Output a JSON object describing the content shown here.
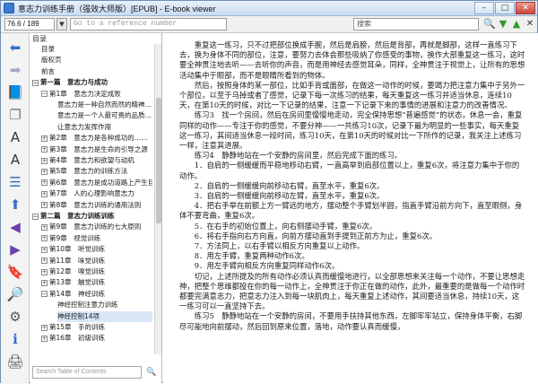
{
  "window": {
    "title": "意志力训练手册（强效大师版）[EPUB] - E-book viewer",
    "minimize": "–",
    "maximize": "□",
    "close": "✕"
  },
  "toolbar": {
    "page_value": "76.6 / 189",
    "goto_placeholder": "Go to a reference number",
    "search_value": "搜索",
    "search_button": "🔍",
    "next_button": "▼",
    "prev_button": "▲",
    "clear_button": "✕"
  },
  "sidebar_icons": [
    {
      "name": "back-arrow-icon",
      "glyph": "⬅",
      "color": "#3a6fc4"
    },
    {
      "name": "forward-arrow-icon",
      "glyph": "➡",
      "color": "#9aa9bf"
    },
    {
      "name": "library-icon",
      "glyph": "📘",
      "color": "#3a6fc4"
    },
    {
      "name": "copy-icon",
      "glyph": "❐",
      "color": "#777777"
    },
    {
      "name": "font-larger-icon",
      "glyph": "A",
      "color": "#333333"
    },
    {
      "name": "font-smaller-icon",
      "glyph": "A",
      "color": "#333333"
    },
    {
      "name": "toc-icon",
      "glyph": "☰",
      "color": "#3a6fc4"
    },
    {
      "name": "previous-page-icon",
      "glyph": "⬆",
      "color": "#3a6fc4"
    },
    {
      "name": "previous-chapter-icon",
      "glyph": "◀",
      "color": "#6a3fb0"
    },
    {
      "name": "next-chapter-icon",
      "glyph": "▶",
      "color": "#6a3fb0"
    },
    {
      "name": "bookmark-icon",
      "glyph": "🔖",
      "color": "#3a6fc4"
    },
    {
      "name": "reference-icon",
      "glyph": "🔎",
      "color": "#3a6fc4"
    },
    {
      "name": "preferences-icon",
      "glyph": "⚙",
      "color": "#555555"
    },
    {
      "name": "info-icon",
      "glyph": "ℹ",
      "color": "#2f6fd0"
    },
    {
      "name": "print-icon",
      "glyph": "🖨",
      "color": "#555555"
    }
  ],
  "toc": {
    "header": "目录",
    "items": [
      {
        "label": "目录",
        "level": 1
      },
      {
        "label": "版权页",
        "level": 1
      },
      {
        "label": "前言",
        "level": 1
      },
      {
        "label": "第一篇　意志力与成功",
        "level": 0,
        "toggle": "−"
      },
      {
        "label": "第1章　意志力决定成败",
        "level": 1,
        "toggle": "−"
      },
      {
        "label": "意志力是一种自然而然的精神……",
        "level": 2
      },
      {
        "label": "意志力是一个人最可贵的品质……",
        "level": 2
      },
      {
        "label": "让意志力发挥作用",
        "level": 2
      },
      {
        "label": "第2章　意志力是各种成功的……",
        "level": 1,
        "toggle": "+"
      },
      {
        "label": "第3章　意志力是生命的引导之源",
        "level": 1,
        "toggle": "+"
      },
      {
        "label": "第4章　意志力和欲望与动机",
        "level": 1,
        "toggle": "+"
      },
      {
        "label": "第5章　意志力的训练方法",
        "level": 1,
        "toggle": "+"
      },
      {
        "label": "第6章　意志力是成功道路上产生巨……",
        "level": 1,
        "toggle": "+"
      },
      {
        "label": "第7章　人的心理影响意志力",
        "level": 1,
        "toggle": "+"
      },
      {
        "label": "第8章　意志力训练的通用法则",
        "level": 1,
        "toggle": "+"
      },
      {
        "label": "第二篇　意志力训练训练",
        "level": 0,
        "toggle": "−"
      },
      {
        "label": "第9章　意志力训练的七大原则",
        "level": 1,
        "toggle": "+"
      },
      {
        "label": "第9章　视觉训练",
        "level": 1,
        "toggle": "+"
      },
      {
        "label": "第10章　听觉训练",
        "level": 1,
        "toggle": "+"
      },
      {
        "label": "第11章　味觉训练",
        "level": 1,
        "toggle": "+"
      },
      {
        "label": "第12章　嗅觉训练",
        "level": 1,
        "toggle": "+"
      },
      {
        "label": "第13章　触觉训练",
        "level": 1,
        "toggle": "+"
      },
      {
        "label": "第14章　神经训练",
        "level": 1,
        "toggle": "−"
      },
      {
        "label": "神经控制注意力训练",
        "level": 2
      },
      {
        "label": "神经控制14项",
        "level": 2,
        "selected": true
      },
      {
        "label": "第15章　手的训练",
        "level": 1,
        "toggle": "+"
      },
      {
        "label": "第16章　初级训练",
        "level": 1,
        "toggle": "+"
      }
    ],
    "search_placeholder": "Search Table of Contents",
    "search_button": "🔍"
  },
  "content": {
    "paragraphs": [
      "重复这一练习，只不过把部位换成手腕，然后是肩膀，然后是背部，再就是脚部，这样一直练习下去，换为身体不同的部位，注意，要努力去体会那些吸纳了你感受的事物，换作大部重复这一练习，这时要全神贯注地去听——去听你的声音，而是用神经去感觉耳朵，同样，全神贯注于视觉上，让所有的思想活动集中于眼部，而不是眼睛所看到的物体。",
      "然后，按照身体的某一部位，比如手背或面部，在做这一动作的时候，要竭力把注意力集中于另外一个部位，以至于马掉或者了感觉，记录下每一次练习的结果，每天重复这一练习并适当休息，连续10天，在第10天的时候，对比一下记录的结果，注意一下记录下来的事情的进展和注意力的改善情况。",
      "练习3　找一个房间，然后在房间里慢慢地走动，完全保持思想“普遍感觉”的状态，休息一会，重复同样的动作——专注于你的感觉，不要分神——一共练习10次，记录下最为明显的一些事实，每天重复这一练习，其间适当休息一段时间，练习10天，在第10天的时候对比一下所作的记录，我关注上述练习一样，注意其进展。",
      "练习4　静静地站在一个安静的房间里，然后完成下面的练习。",
      "1．自肩的一侧缓缓而平稳地移动右臂，一直高举到肩部位置以上，重复6次，将注意力集中于你的动作。",
      "2．自肩的一侧缓缓向前移动右臂，直至水平，重复6次。",
      "3．自肩的一侧缓缓向前移动左臂，直至水平，重复6次。",
      "4．把右手举在前额上方一臂远的地方，摆动整个手臂划半圆，指直手臂沿前方向下，直至眼侧，身体不要弯曲，重复6次。",
      "5．在右手的初始位置上，向右侧摆动手臂，重复6次。",
      "6．将右手指向右方向直，向前方摆动直到手提到正前方为止，重复6次。",
      "7．方法同上，以右手臂以相反方向重复以上动作。",
      "8．用左手臂，重复两种动作6次。",
      "9．用左手臂向相反方向重复同样动作6次。",
      "切记，上述所提及的所有动作必须认真而缓慢地进行，以全部思想来关注每一个动作，不要让思想走神，把整个思维都投在你的每一动作上，全神贯注于你正在做的动作，此外，最重要的是做每一个动作时都要完满意志力，把意志力注入到每一块肌肉上，每天重复上述动作，其间要适当休息，持续10天，这一练习可以一直坚持下去。",
      "练习5　静静地站在一个安静的房间，不要用手扶持其他东西，左脚牢牢站立，保持身体平衡，右脚尽可能地向前摆动，然后回到原来位置，落地，动作要认真而缓慢，"
    ]
  }
}
